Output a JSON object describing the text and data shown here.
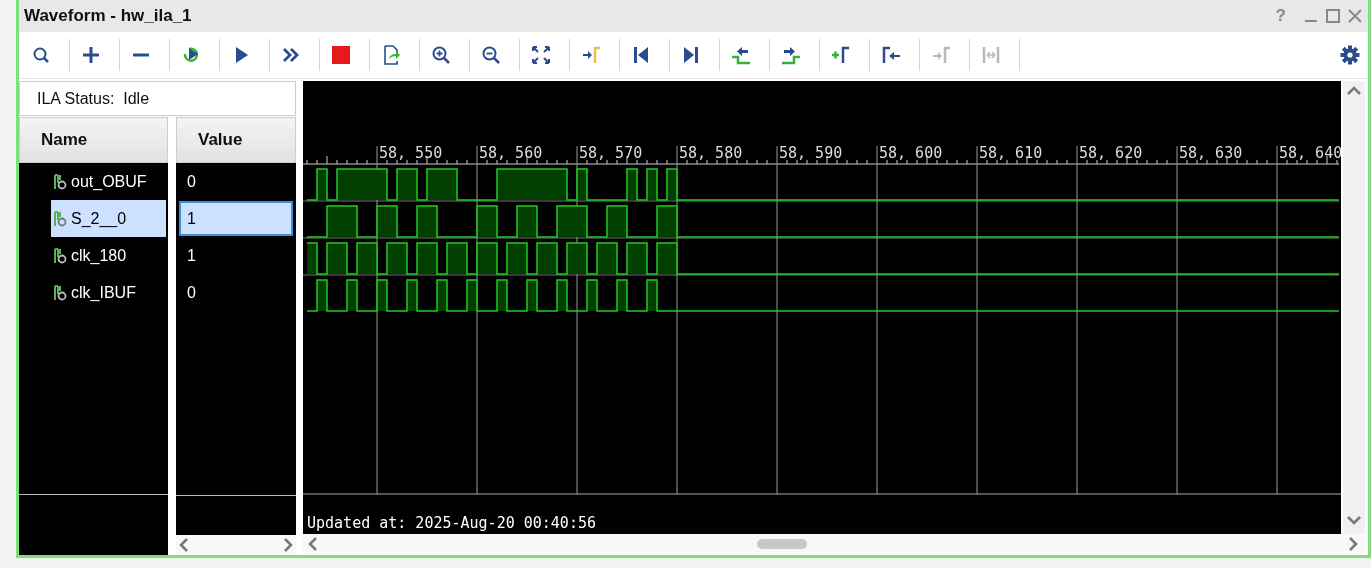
{
  "window": {
    "title": "Waveform - hw_ila_1",
    "help": "?"
  },
  "toolbar": {
    "buttons": [
      {
        "kind": "search",
        "disabled": false
      },
      {
        "kind": "plus",
        "disabled": false
      },
      {
        "kind": "minus",
        "disabled": false
      },
      {
        "kind": "run-trigger",
        "disabled": false
      },
      {
        "kind": "play",
        "disabled": false
      },
      {
        "kind": "fast-forward",
        "disabled": false
      },
      {
        "kind": "stop",
        "disabled": false
      },
      {
        "kind": "export",
        "disabled": false
      },
      {
        "kind": "zoom-in",
        "disabled": false
      },
      {
        "kind": "zoom-out",
        "disabled": false
      },
      {
        "kind": "fit",
        "disabled": false
      },
      {
        "kind": "goto-marker",
        "disabled": false
      },
      {
        "kind": "first",
        "disabled": false
      },
      {
        "kind": "last",
        "disabled": false
      },
      {
        "kind": "prev-transition",
        "disabled": false
      },
      {
        "kind": "next-transition",
        "disabled": false
      },
      {
        "kind": "add-marker",
        "disabled": false
      },
      {
        "kind": "prev-marker",
        "disabled": false
      },
      {
        "kind": "next-marker",
        "disabled": true
      },
      {
        "kind": "swap-markers",
        "disabled": true
      }
    ]
  },
  "ila_status": "ILA Status:  Idle",
  "signals": {
    "columns": [
      "Name",
      "Value"
    ],
    "rows": [
      {
        "name": "out_OBUF",
        "value": "0",
        "selected": false
      },
      {
        "name": "S_2__0",
        "value": "1",
        "selected": true
      },
      {
        "name": "clk_180",
        "value": "1",
        "selected": false
      },
      {
        "name": "clk_IBUF",
        "value": "0",
        "selected": false
      }
    ]
  },
  "waveform": {
    "ruler_labels": [
      "58, 550",
      "58, 560",
      "58, 570",
      "58, 580",
      "58, 590",
      "58, 600",
      "58, 610",
      "58, 620",
      "58, 630",
      "58, 640"
    ],
    "status": "Updated at: 2025-Aug-20 00:40:56"
  }
}
